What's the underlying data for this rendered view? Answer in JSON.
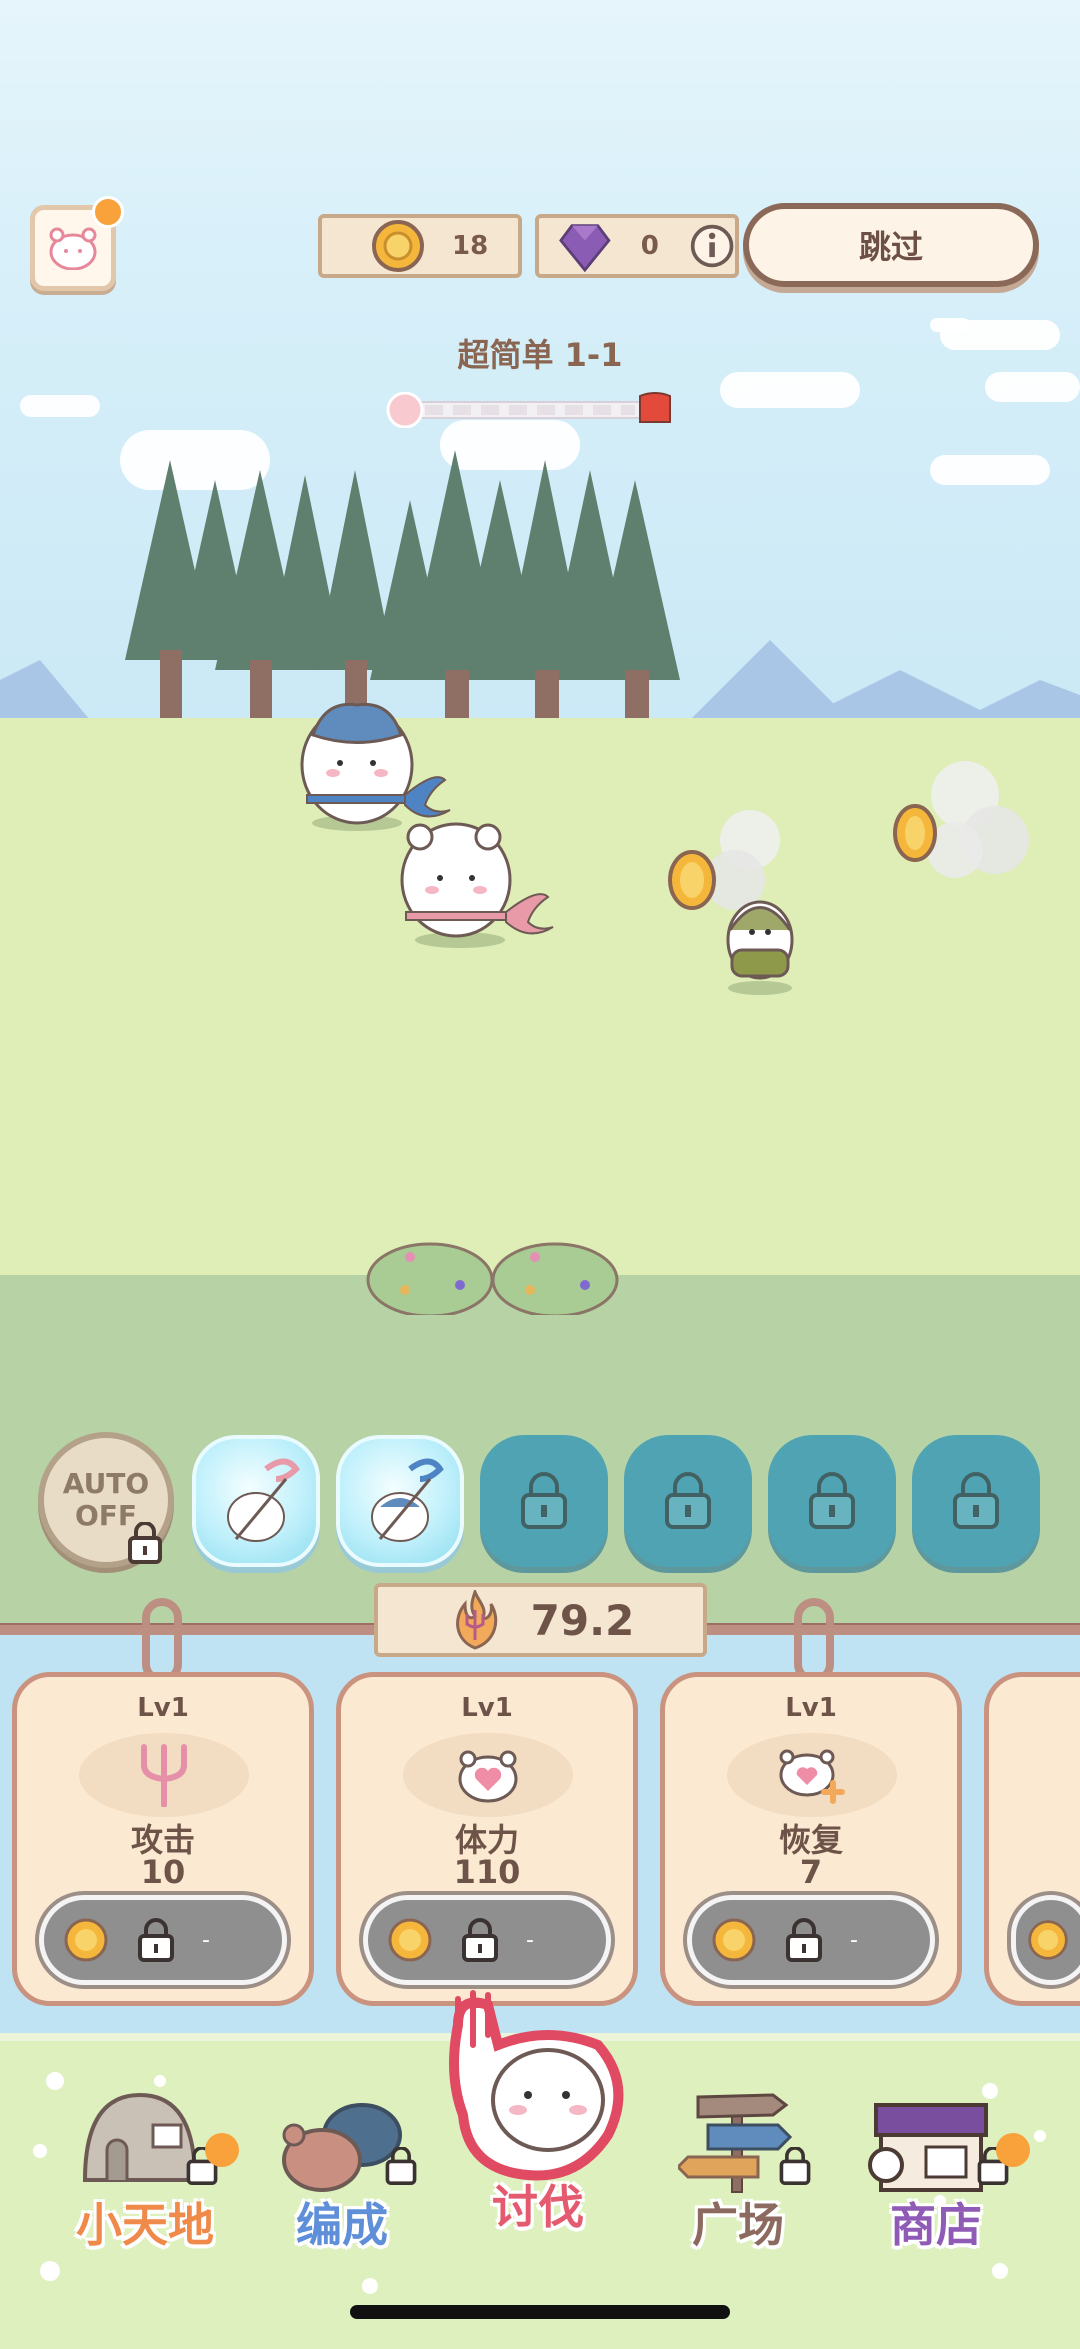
{
  "hud": {
    "gold_count": "18",
    "gem_count": "0",
    "skip_label": "跳过",
    "stage_title": "超简单 1-1"
  },
  "skills": {
    "auto_label_line1": "AUTO",
    "auto_label_line2": "OFF"
  },
  "power": {
    "value": "79.2"
  },
  "upgrades": [
    {
      "level": "Lv1",
      "name": "攻击",
      "value": "10",
      "cost": "-"
    },
    {
      "level": "Lv1",
      "name": "体力",
      "value": "110",
      "cost": "-"
    },
    {
      "level": "Lv1",
      "name": "恢复",
      "value": "7",
      "cost": "-"
    }
  ],
  "nav": [
    {
      "label": "小天地",
      "color": "#f08a4b"
    },
    {
      "label": "编成",
      "color": "#5f8fd8"
    },
    {
      "label": "讨伐",
      "color": "#e45a6e"
    },
    {
      "label": "广场",
      "color": "#8d6a5f"
    },
    {
      "label": "商店",
      "color": "#8f5bb7"
    }
  ],
  "colors": {
    "accent_brown": "#8b6958",
    "coin": "#f5b73b",
    "gem": "#8b5cb3"
  }
}
